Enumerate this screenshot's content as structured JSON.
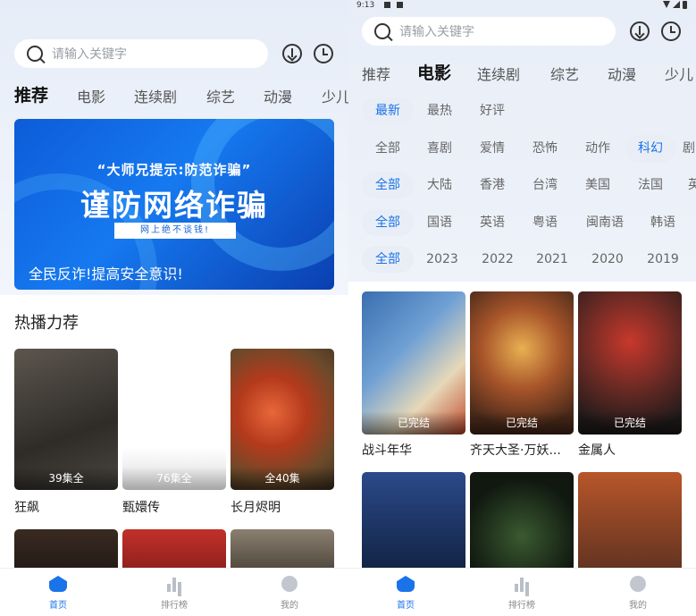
{
  "left": {
    "search_placeholder": "请输入关键字",
    "tabs": [
      "推荐",
      "电影",
      "连续剧",
      "综艺",
      "动漫",
      "少儿"
    ],
    "banner": {
      "line1": "“大师兄提示:防范诈骗”",
      "line2": "谨防网络诈骗",
      "line3": "网上绝不谈钱!",
      "line4": "全民反诈!提高安全意识!"
    },
    "section_title": "热播力荐",
    "cards": [
      {
        "title": "狂飙",
        "badge": "39集全"
      },
      {
        "title": "甄嬛传",
        "badge": "76集全"
      },
      {
        "title": "长月烬明",
        "badge": "全40集"
      }
    ]
  },
  "right": {
    "status_time": "9:13",
    "search_placeholder": "请输入关键字",
    "tabs": [
      "推荐",
      "电影",
      "连续剧",
      "综艺",
      "动漫",
      "少儿"
    ],
    "filters": {
      "sort": [
        "最新",
        "最热",
        "好评"
      ],
      "genre": [
        "全部",
        "喜剧",
        "爱情",
        "恐怖",
        "动作",
        "科幻",
        "剧"
      ],
      "region": [
        "全部",
        "大陆",
        "香港",
        "台湾",
        "美国",
        "法国",
        "英"
      ],
      "language": [
        "全部",
        "国语",
        "英语",
        "粤语",
        "闽南语",
        "韩语"
      ],
      "year": [
        "全部",
        "2023",
        "2022",
        "2021",
        "2020",
        "2019"
      ]
    },
    "cards": [
      {
        "title": "战斗年华",
        "badge": "已完结"
      },
      {
        "title": "齐天大圣·万妖...",
        "badge": "已完结"
      },
      {
        "title": "金属人",
        "badge": "已完结"
      }
    ]
  },
  "nav": {
    "home": "首页",
    "rank": "排行榜",
    "me": "我的"
  },
  "colors": {
    "accent": "#1a73e8",
    "background": "#e8eef8"
  }
}
